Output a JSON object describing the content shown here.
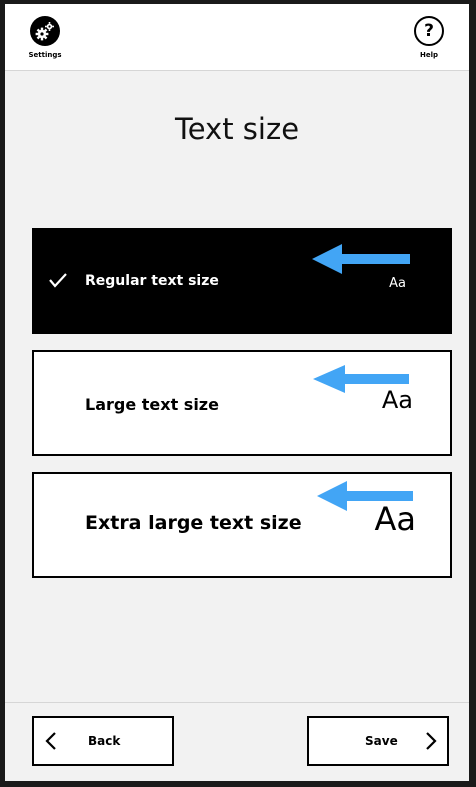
{
  "header": {
    "settings_label": "Settings",
    "help_label": "Help",
    "help_glyph": "?"
  },
  "page": {
    "title": "Text size"
  },
  "options": [
    {
      "label": "Regular text size",
      "sample": "Aa",
      "selected": true
    },
    {
      "label": "Large text size",
      "sample": "Aa",
      "selected": false
    },
    {
      "label": "Extra large text size",
      "sample": "Aa",
      "selected": false
    }
  ],
  "footer": {
    "back_label": "Back",
    "save_label": "Save"
  },
  "colors": {
    "selected_bg": "#000000",
    "arrow": "#42a5f5",
    "background": "#f2f2f2"
  },
  "icons": {
    "settings": "gears-icon",
    "help": "question-icon",
    "selected": "check-icon",
    "pointer": "left-arrow-icon",
    "back": "chevron-left-icon",
    "save": "chevron-right-icon"
  }
}
